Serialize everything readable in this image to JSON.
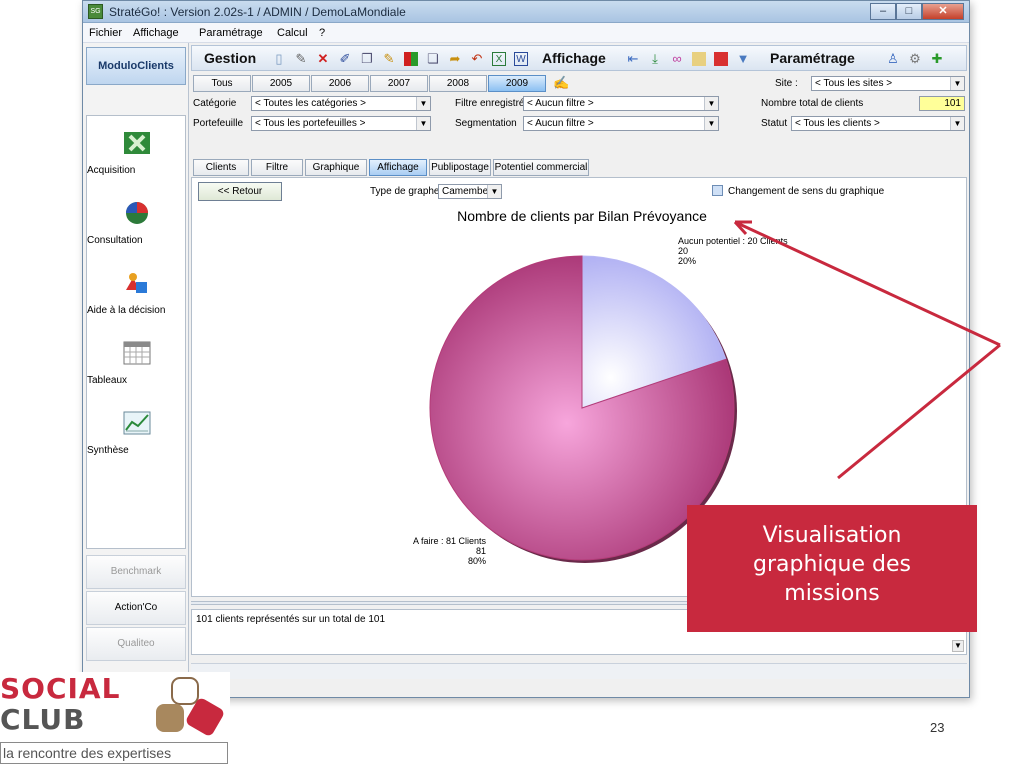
{
  "window": {
    "title": "StratéGo! : Version 2.02s-1 / ADMIN / DemoLaMondiale",
    "caption_minimize": "–",
    "caption_maximize": "□",
    "caption_close": "✕"
  },
  "menu": [
    "Fichier",
    "Affichage",
    "Paramétrage",
    "Calcul",
    "?"
  ],
  "sidebar": {
    "header": "ModuloClients",
    "items": [
      {
        "label": "Acquisition",
        "icon": "excel-icon"
      },
      {
        "label": "Consultation",
        "icon": "pie-chart-icon"
      },
      {
        "label": "Aide à la décision",
        "icon": "shapes-icon"
      },
      {
        "label": "Tableaux",
        "icon": "calendar-grid-icon"
      },
      {
        "label": "Synthèse",
        "icon": "chart-image-icon"
      }
    ],
    "bottom_buttons": [
      "Benchmark",
      "Action'Co",
      "Qualiteo"
    ]
  },
  "toolbar": {
    "gestion": "Gestion",
    "affichage": "Affichage",
    "parametrage": "Paramétrage"
  },
  "year_tabs": {
    "items": [
      "Tous",
      "2005",
      "2006",
      "2007",
      "2008",
      "2009"
    ],
    "selected": "2009"
  },
  "site": {
    "label": "Site :",
    "value": "< Tous les sites >"
  },
  "filters": {
    "categorie": {
      "label": "Catégorie",
      "value": "< Toutes les catégories >"
    },
    "filtre_enregistre": {
      "label": "Filtre enregistré",
      "value": "< Aucun filtre >"
    },
    "nombre_total": {
      "label": "Nombre total de clients",
      "value": "101"
    },
    "portefeuille": {
      "label": "Portefeuille",
      "value": "< Tous les portefeuilles >"
    },
    "segmentation": {
      "label": "Segmentation",
      "value": "< Aucun filtre >"
    },
    "statut": {
      "label": "Statut",
      "value": "< Tous les clients >"
    }
  },
  "subtabs": {
    "items": [
      "Clients",
      "Filtre",
      "Graphique",
      "Affichage",
      "Publipostage",
      "Potentiel commercial"
    ],
    "selected": "Affichage"
  },
  "content": {
    "back_button": "<< Retour",
    "graph_type_label": "Type de graphe",
    "graph_type_value": "Camembert",
    "reverse_label": "Changement de sens du graphique"
  },
  "chart_data": {
    "type": "pie",
    "title": "Nombre de clients par Bilan Prévoyance",
    "slices": [
      {
        "label": "Aucun potentiel : 20 Clients",
        "value": 20,
        "percent": "20%",
        "color": "#b8b8f4"
      },
      {
        "label": "A faire : 81 Clients",
        "value": 81,
        "percent": "80%",
        "color": "#b43c78"
      }
    ]
  },
  "summary": "101 clients représentés sur un total de 101",
  "callout": {
    "lines": [
      "Visualisation",
      "graphique des",
      "missions"
    ],
    "color": "#c8293e"
  },
  "logo": {
    "word1": "SOCIAL",
    "word2": "CLUB",
    "tagline": "la rencontre des expertises"
  },
  "slide_number": "23"
}
